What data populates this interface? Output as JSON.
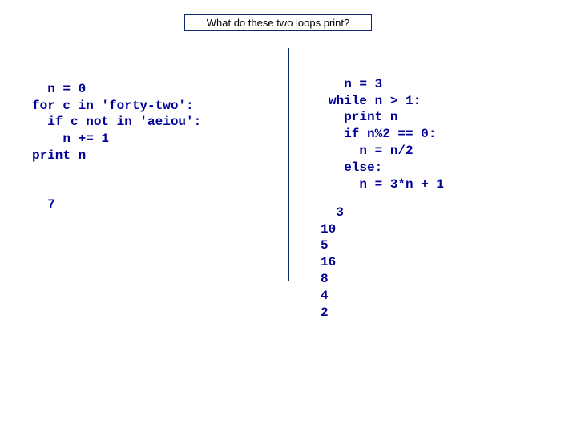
{
  "title": "What do these two loops print?",
  "left": {
    "code": "n = 0\nfor c in 'forty-two':\n  if c not in 'aeiou':\n    n += 1\nprint n",
    "output": "7"
  },
  "right": {
    "code": "n = 3\nwhile n > 1:\n  print n\n  if n%2 == 0:\n    n = n/2\n  else:\n    n = 3*n + 1",
    "output": "3\n10\n5\n16\n8\n4\n2"
  }
}
